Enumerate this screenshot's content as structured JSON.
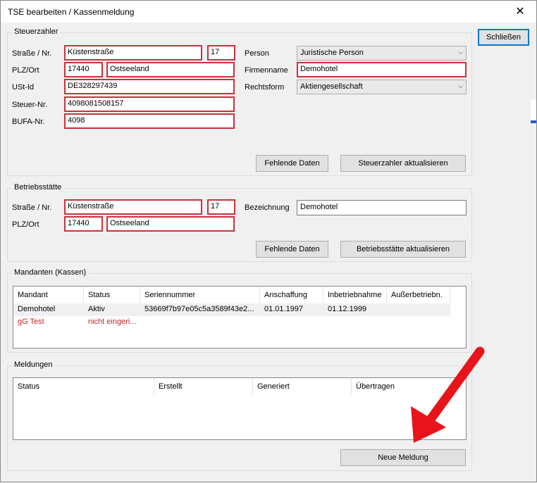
{
  "window": {
    "title": "TSE bearbeiten / Kassenmeldung",
    "close_glyph": "✕"
  },
  "close_button": "Schließen",
  "steuerzahler": {
    "legend": "Steuerzahler",
    "labels": {
      "strasse": "Straße / Nr.",
      "plz": "PLZ/Ort",
      "ustid": "USt-Id",
      "steuernr": "Steuer-Nr.",
      "bufa": "BUFA-Nr.",
      "person": "Person",
      "firmenname": "Firmenname",
      "rechtsform": "Rechtsform"
    },
    "values": {
      "strasse": "Küstenstraße",
      "nr": "17",
      "plz": "17440",
      "ort": "Ostseeland",
      "ustid": "DE328297439",
      "steuernr": "4098081508157",
      "bufa": "4098",
      "person": "Juristische Person",
      "firmenname": "Demohotel",
      "rechtsform": "Aktiengesellschaft"
    },
    "buttons": {
      "fehlende": "Fehlende Daten",
      "aktualisieren": "Steuerzahler aktualisieren"
    }
  },
  "betriebsstaette": {
    "legend": "Betriebsstätte",
    "labels": {
      "strasse": "Straße / Nr.",
      "plz": "PLZ/Ort",
      "bezeichnung": "Bezeichnung"
    },
    "values": {
      "strasse": "Küstenstraße",
      "nr": "17",
      "plz": "17440",
      "ort": "Ostseeland",
      "bezeichnung": "Demohotel"
    },
    "buttons": {
      "fehlende": "Fehlende Daten",
      "aktualisieren": "Betriebsstätte aktualisieren"
    }
  },
  "mandanten": {
    "legend": "Mandanten (Kassen)",
    "columns": [
      "Mandant",
      "Status",
      "Seriennummer",
      "Anschaffung",
      "Inbetriebnahme",
      "Außerbetriebn."
    ],
    "rows": [
      [
        "Demohotel",
        "Aktiv",
        "53669f7b97e05c5a3589f43e2...",
        "01.01.1997",
        "01.12.1999",
        ""
      ],
      [
        "gG Test",
        "nicht eingeri...",
        "",
        "",
        "",
        ""
      ]
    ]
  },
  "meldungen": {
    "legend": "Meldungen",
    "columns": [
      "Status",
      "Erstellt",
      "Generiert",
      "Übertragen"
    ],
    "new_button": "Neue Meldung"
  },
  "colors": {
    "error_border": "#c8323a",
    "error_text": "#c0262d",
    "arrow": "#e8141c",
    "focus": "#0078d7"
  },
  "icons": {
    "close": "close-icon",
    "dropdown": "chevron-down-icon"
  }
}
